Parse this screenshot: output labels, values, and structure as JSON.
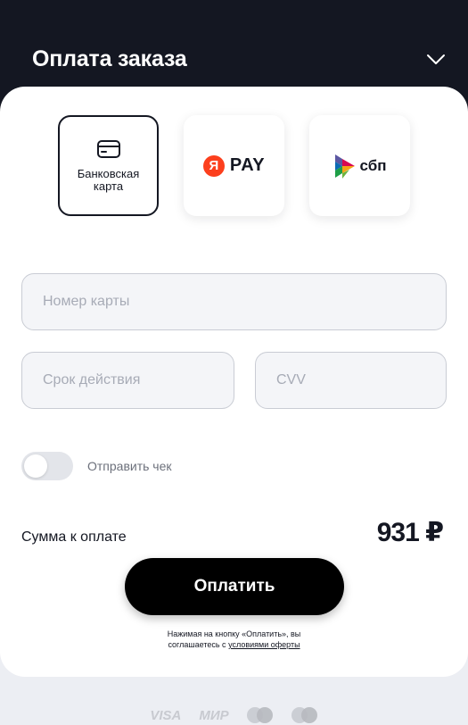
{
  "header": {
    "title": "Оплата заказа",
    "toggle_icon": "chevron-down-icon"
  },
  "payment_methods": [
    {
      "id": "bank_card",
      "label": "Банковская карта",
      "icon": "credit-card-icon",
      "selected": true
    },
    {
      "id": "yandex_pay",
      "logo_letter": "Я",
      "logo_text": "PAY",
      "icon": "yandex-pay-logo",
      "selected": false
    },
    {
      "id": "sbp",
      "logo_text": "сбп",
      "icon": "sbp-logo",
      "selected": false
    }
  ],
  "form": {
    "card_number_placeholder": "Номер карты",
    "expiry_placeholder": "Срок действия",
    "cvv_placeholder": "CVV"
  },
  "receipt": {
    "label": "Отправить чек",
    "enabled": false
  },
  "summary": {
    "label": "Сумма к оплате",
    "amount": "931 ₽"
  },
  "actions": {
    "pay_label": "Оплатить"
  },
  "terms": {
    "text": "Нажимая на кнопку «Оплатить», вы соглашаетесь с",
    "link": "условиями оферты"
  },
  "footer": {
    "logos": [
      "VISA",
      "МИР",
      "mastercard",
      "maestro"
    ]
  },
  "colors": {
    "header_bg": "#141722",
    "accent_red": "#fc3f1d",
    "button_bg": "#000000"
  }
}
